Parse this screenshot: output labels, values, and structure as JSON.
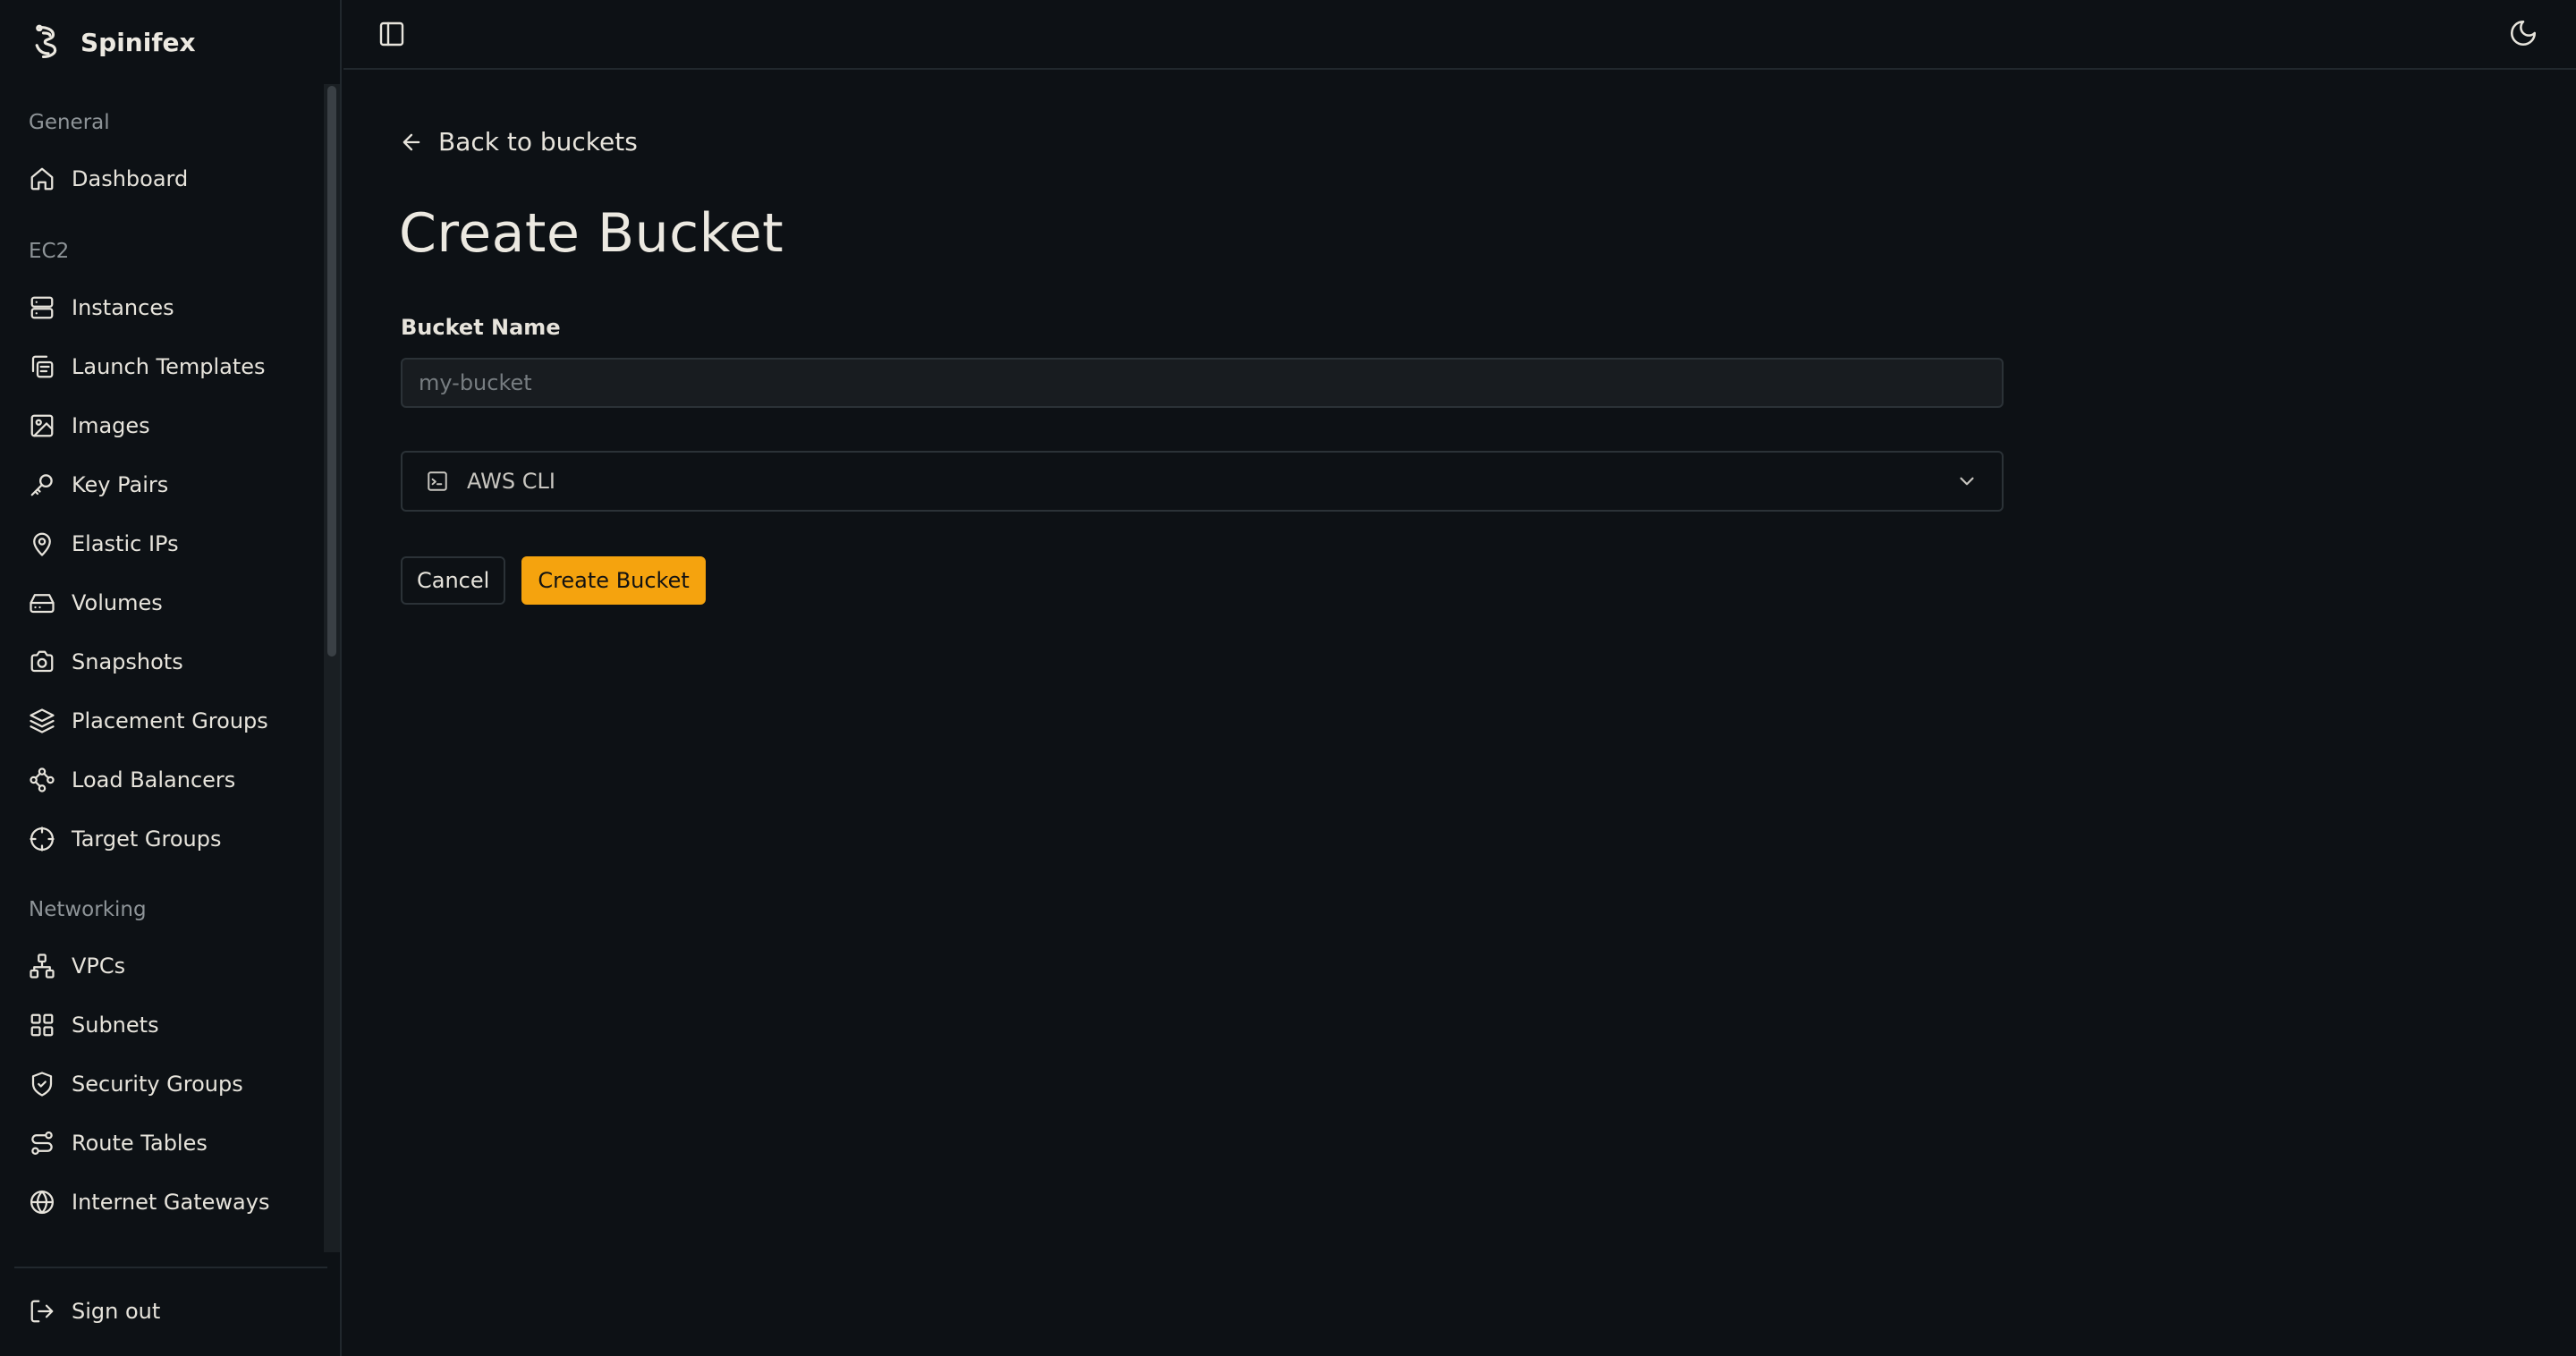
{
  "app": {
    "name": "Spinifex",
    "colors": {
      "accent": "#f5a30e",
      "background": "#0d1115",
      "border": "#21282d"
    }
  },
  "sidebar": {
    "sections": [
      {
        "label": "General",
        "items": [
          {
            "label": "Dashboard",
            "icon": "home-icon"
          }
        ]
      },
      {
        "label": "EC2",
        "items": [
          {
            "label": "Instances",
            "icon": "server-icon"
          },
          {
            "label": "Launch Templates",
            "icon": "copy-icon"
          },
          {
            "label": "Images",
            "icon": "image-icon"
          },
          {
            "label": "Key Pairs",
            "icon": "key-icon"
          },
          {
            "label": "Elastic IPs",
            "icon": "map-pin-icon"
          },
          {
            "label": "Volumes",
            "icon": "hard-drive-icon"
          },
          {
            "label": "Snapshots",
            "icon": "camera-icon"
          },
          {
            "label": "Placement Groups",
            "icon": "layers-icon"
          },
          {
            "label": "Load Balancers",
            "icon": "waypoints-icon"
          },
          {
            "label": "Target Groups",
            "icon": "crosshair-icon"
          }
        ]
      },
      {
        "label": "Networking",
        "items": [
          {
            "label": "VPCs",
            "icon": "network-icon"
          },
          {
            "label": "Subnets",
            "icon": "grid-icon"
          },
          {
            "label": "Security Groups",
            "icon": "shield-check-icon"
          },
          {
            "label": "Route Tables",
            "icon": "route-icon"
          },
          {
            "label": "Internet Gateways",
            "icon": "globe-icon"
          }
        ]
      }
    ],
    "signout_label": "Sign out"
  },
  "topbar": {
    "toggle_icon": "sidebar-panel-icon",
    "theme_icon": "moon-icon"
  },
  "main": {
    "back_label": "Back to buckets",
    "title": "Create Bucket",
    "bucket_name_label": "Bucket Name",
    "bucket_name_placeholder": "my-bucket",
    "bucket_name_value": "",
    "cli_label": "AWS CLI",
    "cancel_label": "Cancel",
    "create_label": "Create Bucket"
  }
}
